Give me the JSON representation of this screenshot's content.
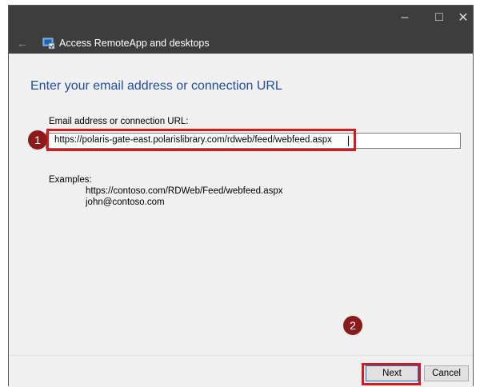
{
  "window": {
    "title": "Access RemoteApp and desktops",
    "controls": {
      "minimize": "–",
      "maximize": "□",
      "close": "✕"
    },
    "back_icon": "←"
  },
  "page": {
    "heading": "Enter your email address or connection URL",
    "field_label": "Email address or connection URL:",
    "url_value": "https://polaris-gate-east.polarislibrary.com/rdweb/feed/webfeed.aspx",
    "examples_label": "Examples:",
    "examples": [
      "https://contoso.com/RDWeb/Feed/webfeed.aspx",
      "john@contoso.com"
    ]
  },
  "footer": {
    "next_label": "Next",
    "cancel_label": "Cancel"
  },
  "annotations": {
    "badge_1": "1",
    "badge_2": "2",
    "highlight_color": "#d4191f",
    "badge_color": "#8b1a1a"
  },
  "colors": {
    "titlebar": "#3d3d3d",
    "heading": "#1f4e9c",
    "background": "#f0f0f0"
  }
}
